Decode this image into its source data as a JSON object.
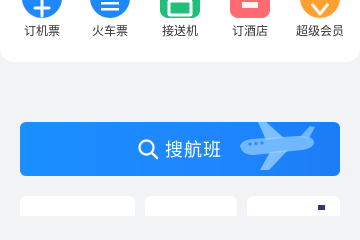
{
  "quick_menu": {
    "items": [
      {
        "label": "订机票",
        "icon": "flight-ticket-icon",
        "color": "#1f88ff"
      },
      {
        "label": "火车票",
        "icon": "train-ticket-icon",
        "color": "#1f88ff"
      },
      {
        "label": "接送机",
        "icon": "airport-transfer-icon",
        "color": "#20c07a"
      },
      {
        "label": "订酒店",
        "icon": "hotel-icon",
        "color": "#ff6b73"
      },
      {
        "label": "超级会员",
        "icon": "super-member-icon",
        "color": "#ffa030"
      }
    ]
  },
  "search": {
    "label": "搜航班",
    "icon": "search-icon",
    "decoration_icon": "airplane-icon",
    "color": "#1e88ff"
  }
}
